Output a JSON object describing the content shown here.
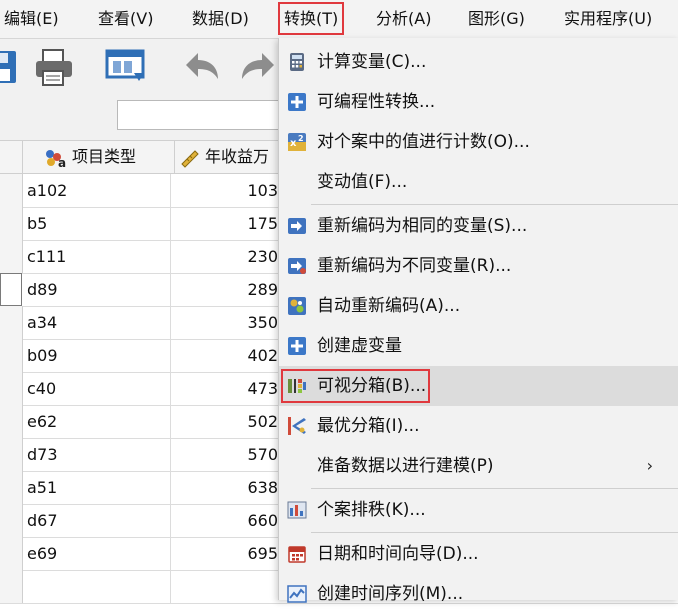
{
  "menubar": {
    "items": [
      {
        "label": "编辑(E)"
      },
      {
        "label": "查看(V)"
      },
      {
        "label": "数据(D)"
      },
      {
        "label": "转换(T)"
      },
      {
        "label": "分析(A)"
      },
      {
        "label": "图形(G)"
      },
      {
        "label": "实用程序(U)"
      }
    ]
  },
  "grid": {
    "columns": [
      {
        "label": "项目类型"
      },
      {
        "label": "年收益万"
      }
    ],
    "rows": [
      {
        "id": "a102",
        "value": "103"
      },
      {
        "id": "b5",
        "value": "175"
      },
      {
        "id": "c111",
        "value": "230"
      },
      {
        "id": "d89",
        "value": "289"
      },
      {
        "id": "a34",
        "value": "350"
      },
      {
        "id": "b09",
        "value": "402"
      },
      {
        "id": "c40",
        "value": "473"
      },
      {
        "id": "e62",
        "value": "502"
      },
      {
        "id": "d73",
        "value": "570"
      },
      {
        "id": "a51",
        "value": "638"
      },
      {
        "id": "d67",
        "value": "660"
      },
      {
        "id": "e69",
        "value": "695"
      }
    ]
  },
  "dropdown": {
    "items": [
      {
        "label": "计算变量(C)...",
        "icon": "calculator-icon"
      },
      {
        "label": "可编程性转换...",
        "icon": "plus-icon"
      },
      {
        "label": "对个案中的值进行计数(O)...",
        "icon": "count-icon"
      },
      {
        "label": "变动值(F)...",
        "icon": ""
      },
      {
        "label": "重新编码为相同的变量(S)...",
        "icon": "recode-same-icon"
      },
      {
        "label": "重新编码为不同变量(R)...",
        "icon": "recode-different-icon"
      },
      {
        "label": "自动重新编码(A)...",
        "icon": "auto-recode-icon"
      },
      {
        "label": "创建虚变量",
        "icon": "plus-icon"
      },
      {
        "label": "可视分箱(B)...",
        "icon": "visual-binning-icon"
      },
      {
        "label": "最优分箱(I)...",
        "icon": "optimal-binning-icon"
      },
      {
        "label": "准备数据以进行建模(P)",
        "icon": "",
        "submenu": "›"
      },
      {
        "label": "个案排秩(K)...",
        "icon": "rank-cases-icon"
      },
      {
        "label": "日期和时间向导(D)...",
        "icon": "calendar-icon"
      },
      {
        "label": "创建时间序列(M)...",
        "icon": "time-series-icon"
      }
    ]
  },
  "colors": {
    "highlight_border": "#e0393e",
    "menu_bg": "#f2f2f2",
    "hover_bg": "#dcdcdc"
  }
}
